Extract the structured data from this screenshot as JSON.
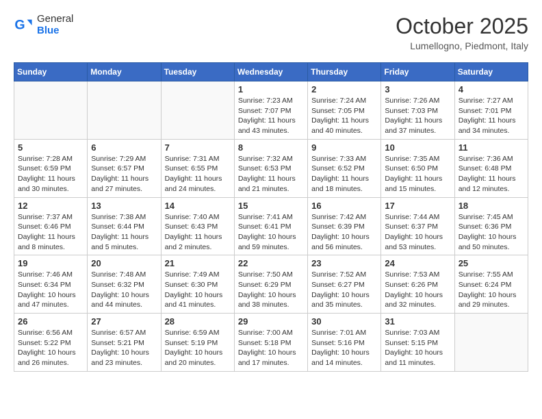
{
  "header": {
    "logo_general": "General",
    "logo_blue": "Blue",
    "title": "October 2025",
    "subtitle": "Lumellogno, Piedmont, Italy"
  },
  "weekdays": [
    "Sunday",
    "Monday",
    "Tuesday",
    "Wednesday",
    "Thursday",
    "Friday",
    "Saturday"
  ],
  "weeks": [
    [
      {
        "day": "",
        "info": ""
      },
      {
        "day": "",
        "info": ""
      },
      {
        "day": "",
        "info": ""
      },
      {
        "day": "1",
        "info": "Sunrise: 7:23 AM\nSunset: 7:07 PM\nDaylight: 11 hours and 43 minutes."
      },
      {
        "day": "2",
        "info": "Sunrise: 7:24 AM\nSunset: 7:05 PM\nDaylight: 11 hours and 40 minutes."
      },
      {
        "day": "3",
        "info": "Sunrise: 7:26 AM\nSunset: 7:03 PM\nDaylight: 11 hours and 37 minutes."
      },
      {
        "day": "4",
        "info": "Sunrise: 7:27 AM\nSunset: 7:01 PM\nDaylight: 11 hours and 34 minutes."
      }
    ],
    [
      {
        "day": "5",
        "info": "Sunrise: 7:28 AM\nSunset: 6:59 PM\nDaylight: 11 hours and 30 minutes."
      },
      {
        "day": "6",
        "info": "Sunrise: 7:29 AM\nSunset: 6:57 PM\nDaylight: 11 hours and 27 minutes."
      },
      {
        "day": "7",
        "info": "Sunrise: 7:31 AM\nSunset: 6:55 PM\nDaylight: 11 hours and 24 minutes."
      },
      {
        "day": "8",
        "info": "Sunrise: 7:32 AM\nSunset: 6:53 PM\nDaylight: 11 hours and 21 minutes."
      },
      {
        "day": "9",
        "info": "Sunrise: 7:33 AM\nSunset: 6:52 PM\nDaylight: 11 hours and 18 minutes."
      },
      {
        "day": "10",
        "info": "Sunrise: 7:35 AM\nSunset: 6:50 PM\nDaylight: 11 hours and 15 minutes."
      },
      {
        "day": "11",
        "info": "Sunrise: 7:36 AM\nSunset: 6:48 PM\nDaylight: 11 hours and 12 minutes."
      }
    ],
    [
      {
        "day": "12",
        "info": "Sunrise: 7:37 AM\nSunset: 6:46 PM\nDaylight: 11 hours and 8 minutes."
      },
      {
        "day": "13",
        "info": "Sunrise: 7:38 AM\nSunset: 6:44 PM\nDaylight: 11 hours and 5 minutes."
      },
      {
        "day": "14",
        "info": "Sunrise: 7:40 AM\nSunset: 6:43 PM\nDaylight: 11 hours and 2 minutes."
      },
      {
        "day": "15",
        "info": "Sunrise: 7:41 AM\nSunset: 6:41 PM\nDaylight: 10 hours and 59 minutes."
      },
      {
        "day": "16",
        "info": "Sunrise: 7:42 AM\nSunset: 6:39 PM\nDaylight: 10 hours and 56 minutes."
      },
      {
        "day": "17",
        "info": "Sunrise: 7:44 AM\nSunset: 6:37 PM\nDaylight: 10 hours and 53 minutes."
      },
      {
        "day": "18",
        "info": "Sunrise: 7:45 AM\nSunset: 6:36 PM\nDaylight: 10 hours and 50 minutes."
      }
    ],
    [
      {
        "day": "19",
        "info": "Sunrise: 7:46 AM\nSunset: 6:34 PM\nDaylight: 10 hours and 47 minutes."
      },
      {
        "day": "20",
        "info": "Sunrise: 7:48 AM\nSunset: 6:32 PM\nDaylight: 10 hours and 44 minutes."
      },
      {
        "day": "21",
        "info": "Sunrise: 7:49 AM\nSunset: 6:30 PM\nDaylight: 10 hours and 41 minutes."
      },
      {
        "day": "22",
        "info": "Sunrise: 7:50 AM\nSunset: 6:29 PM\nDaylight: 10 hours and 38 minutes."
      },
      {
        "day": "23",
        "info": "Sunrise: 7:52 AM\nSunset: 6:27 PM\nDaylight: 10 hours and 35 minutes."
      },
      {
        "day": "24",
        "info": "Sunrise: 7:53 AM\nSunset: 6:26 PM\nDaylight: 10 hours and 32 minutes."
      },
      {
        "day": "25",
        "info": "Sunrise: 7:55 AM\nSunset: 6:24 PM\nDaylight: 10 hours and 29 minutes."
      }
    ],
    [
      {
        "day": "26",
        "info": "Sunrise: 6:56 AM\nSunset: 5:22 PM\nDaylight: 10 hours and 26 minutes."
      },
      {
        "day": "27",
        "info": "Sunrise: 6:57 AM\nSunset: 5:21 PM\nDaylight: 10 hours and 23 minutes."
      },
      {
        "day": "28",
        "info": "Sunrise: 6:59 AM\nSunset: 5:19 PM\nDaylight: 10 hours and 20 minutes."
      },
      {
        "day": "29",
        "info": "Sunrise: 7:00 AM\nSunset: 5:18 PM\nDaylight: 10 hours and 17 minutes."
      },
      {
        "day": "30",
        "info": "Sunrise: 7:01 AM\nSunset: 5:16 PM\nDaylight: 10 hours and 14 minutes."
      },
      {
        "day": "31",
        "info": "Sunrise: 7:03 AM\nSunset: 5:15 PM\nDaylight: 10 hours and 11 minutes."
      },
      {
        "day": "",
        "info": ""
      }
    ]
  ]
}
